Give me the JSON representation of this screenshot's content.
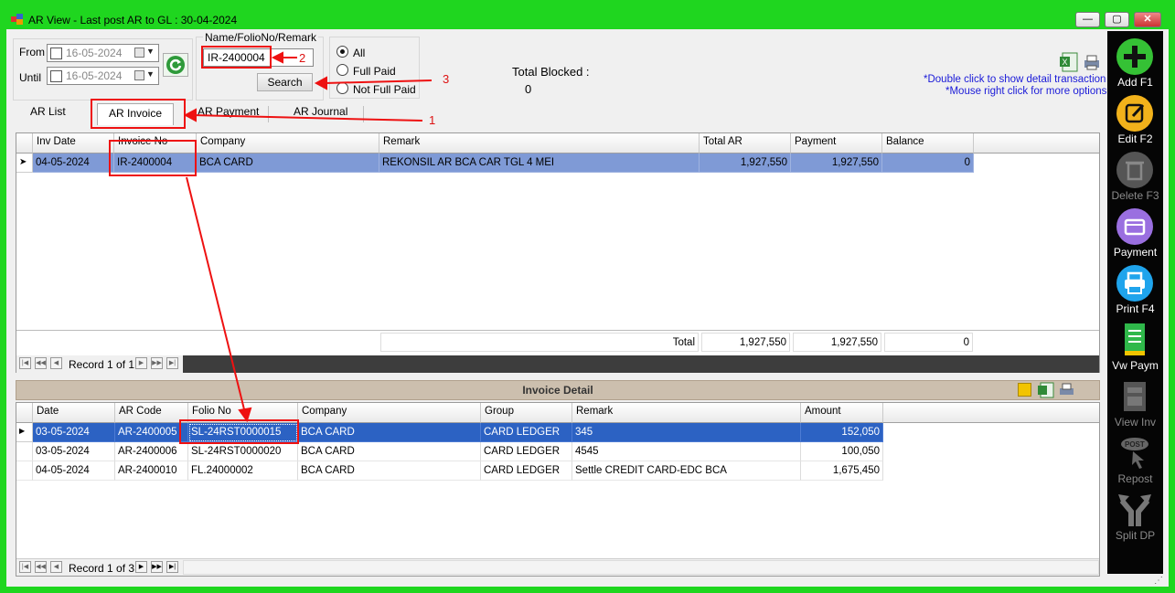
{
  "window": {
    "title": "AR View - Last post AR to GL : 30-04-2024",
    "min": "—",
    "max": "▢",
    "close": "✕"
  },
  "filter": {
    "from_label": "From",
    "until_label": "Until",
    "from_value": "16-05-2024",
    "until_value": "16-05-2024",
    "search_group_label": "Name/FolioNo/Remark",
    "search_value": "IR-2400004",
    "search_button": "Search",
    "radio_all": "All",
    "radio_full": "Full Paid",
    "radio_notfull": "Not Full Paid",
    "total_blocked_label": "Total Blocked :",
    "total_blocked_value": "0",
    "hint1": "*Double click to show detail transaction",
    "hint2": "*Mouse right click for more options"
  },
  "annotations": {
    "a1": "1",
    "a2": "2",
    "a3": "3"
  },
  "tabs": [
    "AR List",
    "AR Invoice",
    "AR Payment",
    "AR Journal"
  ],
  "top_grid": {
    "headers": [
      "Inv Date",
      "Invoice No",
      "Company",
      "Remark",
      "Total AR",
      "Payment",
      "Balance"
    ],
    "rows": [
      [
        "04-05-2024",
        "IR-2400004",
        "BCA CARD",
        "REKONSIL AR BCA CAR TGL 4 MEI",
        "1,927,550",
        "1,927,550",
        "0"
      ]
    ],
    "total_label": "Total",
    "total_ar": "1,927,550",
    "total_payment": "1,927,550",
    "total_balance": "0",
    "record": "Record 1 of 1"
  },
  "detail": {
    "title": "Invoice Detail",
    "headers": [
      "Date",
      "AR Code",
      "Folio No",
      "Company",
      "Group",
      "Remark",
      "Amount"
    ],
    "rows": [
      [
        "03-05-2024",
        "AR-2400005",
        "SL-24RST0000015",
        "BCA CARD",
        "CARD LEDGER",
        "345",
        "152,050"
      ],
      [
        "03-05-2024",
        "AR-2400006",
        "SL-24RST0000020",
        "BCA CARD",
        "CARD LEDGER",
        "4545",
        "100,050"
      ],
      [
        "04-05-2024",
        "AR-2400010",
        "FL.24000002",
        "BCA CARD",
        "CARD LEDGER",
        "Settle CREDIT CARD-EDC BCA",
        "1,675,450"
      ]
    ],
    "record": "Record 1 of 3"
  },
  "sidebar": [
    {
      "label": "Add F1",
      "color": "#35c135",
      "icon": "plus-icon"
    },
    {
      "label": "Edit F2",
      "color": "#f2b21b",
      "icon": "edit-icon"
    },
    {
      "label": "Delete F3",
      "color": "#555555",
      "icon": "trash-icon"
    },
    {
      "label": "Payment",
      "color": "#9a6fe0",
      "icon": "wallet-icon"
    },
    {
      "label": "Print F4",
      "color": "#1fa4ec",
      "icon": "printer-icon"
    },
    {
      "label": "Vw Paym",
      "color": "#2fb84a",
      "icon": "receipt-icon"
    },
    {
      "label": "View Inv",
      "color": "#555555",
      "icon": "invoice-icon"
    },
    {
      "label": "Repost",
      "color": "#555555",
      "icon": "post-icon"
    },
    {
      "label": "Split DP",
      "color": "#555555",
      "icon": "split-icon"
    }
  ]
}
